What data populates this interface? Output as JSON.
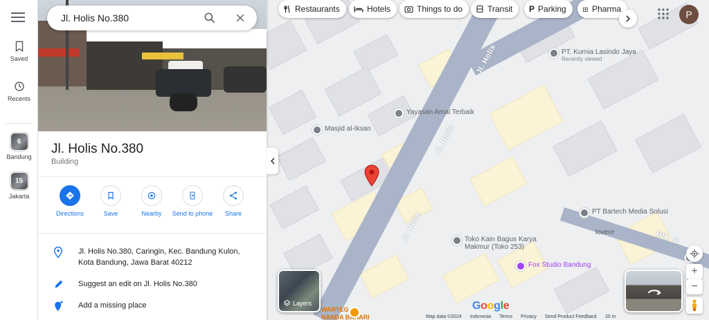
{
  "search": {
    "query": "Jl. Holis No.380"
  },
  "rail": {
    "saved_label": "Saved",
    "recents_label": "Recents",
    "recent_places": [
      {
        "label": "Bandung",
        "count": "6"
      },
      {
        "label": "Jakarta",
        "count": "15"
      }
    ]
  },
  "place": {
    "title": "Jl. Holis No.380",
    "category": "Building",
    "address": "Jl. Holis No.380, Caringin, Kec. Bandung Kulon, Kota Bandung, Jawa Barat 40212",
    "suggest_edit": "Suggest an edit on Jl. Holis No.380",
    "add_place": "Add a missing place"
  },
  "actions": {
    "directions": "Directions",
    "save": "Save",
    "nearby": "Nearby",
    "send_to_phone": "Send to phone",
    "share": "Share"
  },
  "chips": {
    "restaurants": "Restaurants",
    "hotels": "Hotels",
    "things_to_do": "Things to do",
    "transit": "Transit",
    "parking": "Parking",
    "pharmacies": "Pharma"
  },
  "avatar_initial": "P",
  "map": {
    "roads": {
      "holis_1": "Jl. Holis",
      "holis_2": "Jl. Holis",
      "holis_3": "Jl. Holis",
      "blk_b": "Blk. B"
    },
    "pois": {
      "kurnia": "PT. Kurnia Lasindo Jaya",
      "kurnia_sub": "Recently viewed",
      "yayasan": "Yayasan Amal Terbaik",
      "masjid": "Masjid al-Iksan",
      "bartech": "PT Bartech Media Solusi",
      "lovere": "lovere",
      "toko_kain_1": "Toko Kain Bagus Karya",
      "toko_kain_2": "Makmur (Toko 253)",
      "fox": "Fox Studio Bandung",
      "warteg_1": "WARTEG",
      "warteg_2": "NANDA BAHARI"
    },
    "layers_label": "Layers",
    "google_logo": "Google",
    "footer": {
      "map_data": "Map data ©2024",
      "indonesia": "Indonesia",
      "terms": "Terms",
      "privacy": "Privacy",
      "feedback": "Send Product Feedback",
      "scale": "20 m"
    }
  },
  "colors": {
    "accent": "#1a73e8",
    "pin": "#ea4335",
    "road": "#aab4c8",
    "avatar": "#6d4c41"
  }
}
